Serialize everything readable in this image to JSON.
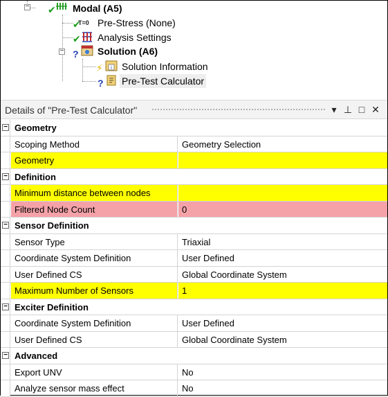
{
  "tree": {
    "modal_label": "Modal (A5)",
    "prestress_label": "Pre-Stress (None)",
    "analysis_settings_label": "Analysis Settings",
    "solution_label": "Solution (A6)",
    "solution_info_label": "Solution Information",
    "pretest_label": "Pre-Test Calculator",
    "prestress_icon_text": "T=0",
    "info_icon_text": "i"
  },
  "details": {
    "title": "Details of \"Pre-Test Calculator\"",
    "sections": [
      {
        "name": "Geometry",
        "rows": [
          {
            "prop": "Scoping Method",
            "value": "Geometry Selection",
            "state": "normal"
          },
          {
            "prop": "Geometry",
            "value": "",
            "state": "yellow"
          }
        ]
      },
      {
        "name": "Definition",
        "rows": [
          {
            "prop": "Minimum distance between nodes",
            "value": "",
            "state": "yellow"
          },
          {
            "prop": "Filtered Node Count",
            "value": "0",
            "state": "red"
          }
        ]
      },
      {
        "name": "Sensor Definition",
        "rows": [
          {
            "prop": "Sensor Type",
            "value": "Triaxial",
            "state": "normal"
          },
          {
            "prop": "Coordinate System Definition",
            "value": "User Defined",
            "state": "normal"
          },
          {
            "prop": "User Defined CS",
            "value": "Global Coordinate System",
            "state": "normal"
          },
          {
            "prop": "Maximum Number of Sensors",
            "value": "1",
            "state": "yellow"
          }
        ]
      },
      {
        "name": "Exciter Definition",
        "rows": [
          {
            "prop": "Coordinate System Definition",
            "value": "User Defined",
            "state": "normal"
          },
          {
            "prop": "User Defined CS",
            "value": "Global Coordinate System",
            "state": "normal"
          }
        ]
      },
      {
        "name": "Advanced",
        "rows": [
          {
            "prop": "Export UNV",
            "value": "No",
            "state": "normal"
          },
          {
            "prop": "Analyze sensor mass effect",
            "value": "No",
            "state": "normal"
          }
        ]
      }
    ]
  },
  "colors": {
    "yellow_highlight": "#ffff00",
    "red_highlight": "#f4a2a8",
    "check_green": "#1a9e1a",
    "question_blue": "#1f3fb5"
  }
}
